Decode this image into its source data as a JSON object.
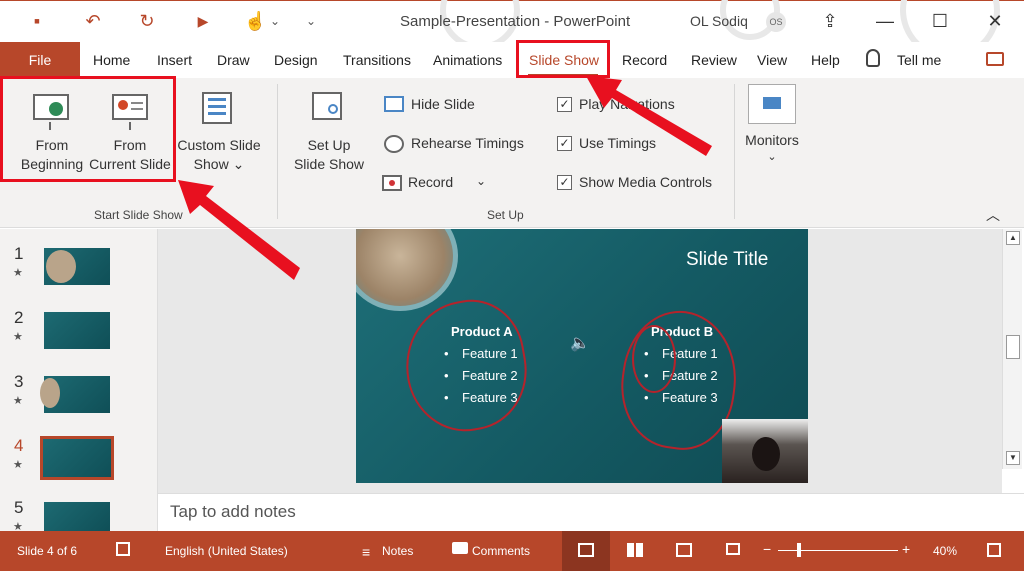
{
  "window": {
    "doc_title": "Sample-Presentation  -  PowerPoint",
    "user_name": "OL Sodiq",
    "user_initials": "OS",
    "controls": {
      "ribbon_display": "⇪",
      "minimize": "—",
      "maximize": "☐",
      "close": "✕"
    }
  },
  "qat": {
    "save_icon": "▪",
    "undo_icon": "↶",
    "redo_icon": "↻",
    "present_icon": "▶",
    "touch_icon": "☝",
    "customize_icon": "⌄"
  },
  "tabs": {
    "file": "File",
    "home": "Home",
    "insert": "Insert",
    "draw": "Draw",
    "design": "Design",
    "transitions": "Transitions",
    "animations": "Animations",
    "slideshow": "Slide Show",
    "record": "Record",
    "review": "Review",
    "view": "View",
    "help": "Help",
    "tell_me": "Tell me"
  },
  "ribbon": {
    "start_group": {
      "label": "Start Slide Show",
      "from_beginning_line1": "From",
      "from_beginning_line2": "Beginning",
      "from_current_line1": "From",
      "from_current_line2": "Current Slide",
      "custom_line1": "Custom Slide",
      "custom_line2": "Show ⌄"
    },
    "setup_group": {
      "label": "Set Up",
      "setup_line1": "Set Up",
      "setup_line2": "Slide Show",
      "hide_slide": "Hide Slide",
      "rehearse": "Rehearse Timings",
      "record": "Record",
      "record_chevron": "⌄",
      "play_narrations": "Play Narrations",
      "use_timings": "Use Timings",
      "show_media_controls": "Show Media Controls",
      "check_mark": "✓"
    },
    "monitors": {
      "label": "Monitors",
      "chevron": "⌄"
    },
    "collapse": "︿"
  },
  "thumbnails": [
    {
      "num": "1",
      "star": "★"
    },
    {
      "num": "2",
      "star": "★"
    },
    {
      "num": "3",
      "star": "★"
    },
    {
      "num": "4",
      "star": "★"
    },
    {
      "num": "5",
      "star": "★"
    }
  ],
  "slide": {
    "title": "Slide Title",
    "product_a": {
      "heading": "Product A",
      "features": [
        "Feature 1",
        "Feature 2",
        "Feature 3"
      ]
    },
    "product_b": {
      "heading": "Product B",
      "features": [
        "Feature 1",
        "Feature 2",
        "Feature 3"
      ]
    },
    "bullet": "•",
    "speaker_icon": "🔈"
  },
  "notes": {
    "placeholder": "Tap to add notes"
  },
  "statusbar": {
    "slide_count": "Slide 4 of 6",
    "language": "English (United States)",
    "notes": "Notes",
    "comments": "Comments",
    "zoom": "40%",
    "zoom_minus": "−",
    "zoom_plus": "+"
  },
  "colors": {
    "accent": "#b7472a",
    "highlight": "#e8101f",
    "slide_bg": "#1e6f78"
  }
}
